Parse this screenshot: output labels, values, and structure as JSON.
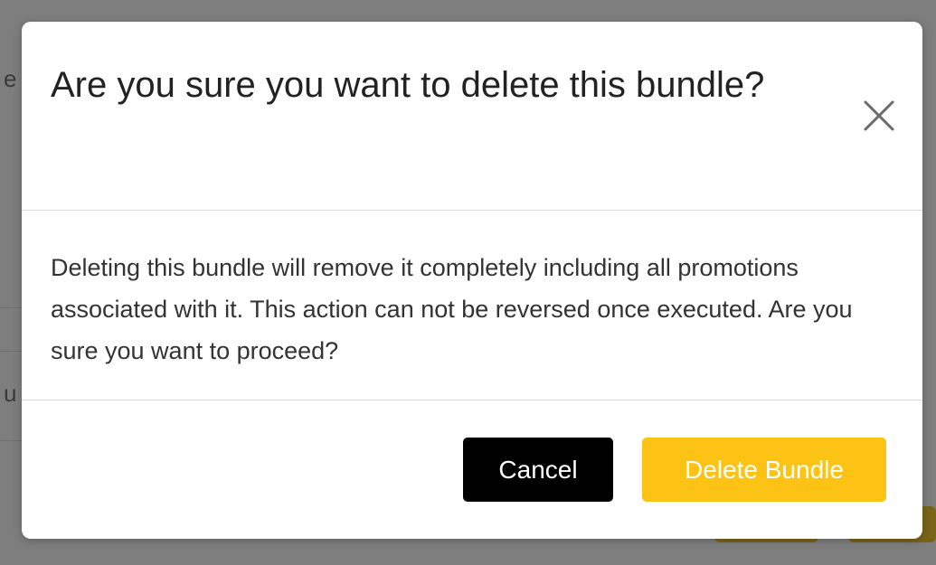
{
  "background": {
    "fragment_top": "e",
    "fragment_mid": "u"
  },
  "modal": {
    "title": "Are you sure you want to delete this bundle?",
    "close_icon": "close-icon",
    "body": "Deleting this bundle will remove it completely including all promotions associated with it. This action can not be reversed once executed. Are you sure you want to proceed?",
    "cancel_label": "Cancel",
    "delete_label": "Delete Bundle"
  },
  "colors": {
    "overlay": "#7f7f7f",
    "cancel_bg": "#000000",
    "delete_bg": "#fcc314",
    "button_text": "#ffffff"
  }
}
